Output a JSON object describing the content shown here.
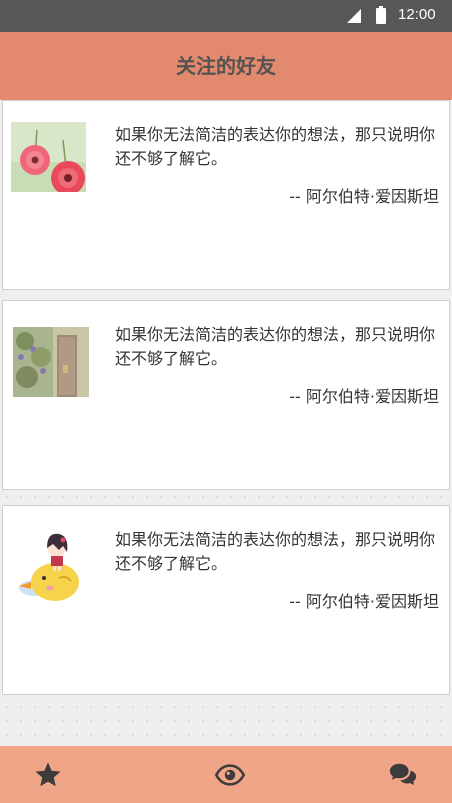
{
  "status_bar": {
    "time": "12:00"
  },
  "header": {
    "title": "关注的好友"
  },
  "posts": [
    {
      "text": "如果你无法简洁的表达你的想法，那只说明你还不够了解它。",
      "author": "-- 阿尔伯特·爱因斯坦",
      "avatar": "pink-flowers-photo"
    },
    {
      "text": "如果你无法简洁的表达你的想法，那只说明你还不够了解它。",
      "author": "-- 阿尔伯特·爱因斯坦",
      "avatar": "garden-door-photo"
    },
    {
      "text": "如果你无法简洁的表达你的想法，那只说明你还不够了解它。",
      "author": "-- 阿尔伯特·爱因斯坦",
      "avatar": "cartoon-girl-on-chick"
    }
  ],
  "bottom_nav": {
    "items": [
      {
        "icon": "star-icon"
      },
      {
        "icon": "eye-icon"
      },
      {
        "icon": "chat-bubbles-icon"
      }
    ]
  },
  "colors": {
    "status_bar": "#585656",
    "header": "#e2896e",
    "bottom_nav": "#f0a587",
    "icon": "#3d3b3b",
    "title_text": "#555352"
  }
}
